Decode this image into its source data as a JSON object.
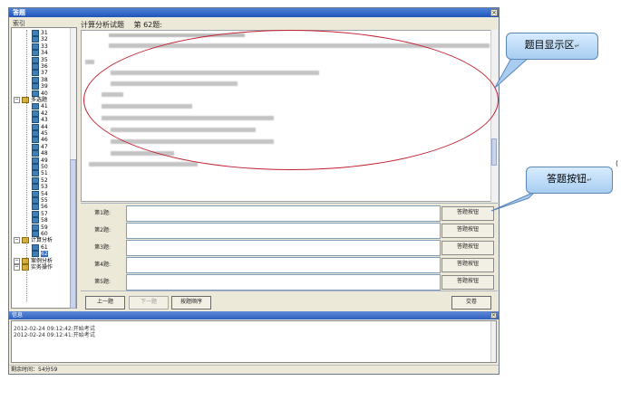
{
  "window": {
    "title": "答题"
  },
  "tree": {
    "title": "索引",
    "items": [
      {
        "label": "31",
        "type": "q"
      },
      {
        "label": "32",
        "type": "q"
      },
      {
        "label": "33",
        "type": "q"
      },
      {
        "label": "34",
        "type": "q"
      },
      {
        "label": "35",
        "type": "q"
      },
      {
        "label": "36",
        "type": "q"
      },
      {
        "label": "37",
        "type": "q"
      },
      {
        "label": "38",
        "type": "q"
      },
      {
        "label": "39",
        "type": "q"
      },
      {
        "label": "40",
        "type": "q"
      },
      {
        "label": "多选题",
        "type": "folder"
      },
      {
        "label": "41",
        "type": "q"
      },
      {
        "label": "42",
        "type": "q"
      },
      {
        "label": "43",
        "type": "q"
      },
      {
        "label": "44",
        "type": "q"
      },
      {
        "label": "45",
        "type": "q"
      },
      {
        "label": "46",
        "type": "q"
      },
      {
        "label": "47",
        "type": "q"
      },
      {
        "label": "48",
        "type": "q"
      },
      {
        "label": "49",
        "type": "q"
      },
      {
        "label": "50",
        "type": "q"
      },
      {
        "label": "51",
        "type": "q"
      },
      {
        "label": "52",
        "type": "q"
      },
      {
        "label": "53",
        "type": "q"
      },
      {
        "label": "54",
        "type": "q"
      },
      {
        "label": "55",
        "type": "q"
      },
      {
        "label": "56",
        "type": "q"
      },
      {
        "label": "57",
        "type": "q"
      },
      {
        "label": "58",
        "type": "q"
      },
      {
        "label": "59",
        "type": "q"
      },
      {
        "label": "60",
        "type": "q"
      },
      {
        "label": "计算分析",
        "type": "folder"
      },
      {
        "label": "61",
        "type": "q"
      },
      {
        "label": "62",
        "type": "q",
        "selected": true
      },
      {
        "label": "案例分析",
        "type": "folder"
      },
      {
        "label": "实务操作",
        "type": "folder"
      }
    ]
  },
  "question": {
    "category": "计算分析试题",
    "number": "第 62题:"
  },
  "answers": {
    "rows": [
      {
        "label": "第1题:",
        "button": "答题按钮"
      },
      {
        "label": "第2题:",
        "button": "答题按钮"
      },
      {
        "label": "第3题:",
        "button": "答题按钮"
      },
      {
        "label": "第4题:",
        "button": "答题按钮"
      },
      {
        "label": "第5题:",
        "button": "答题按钮"
      }
    ]
  },
  "nav": {
    "prev": "上一题",
    "next": "下一题",
    "order": "按题顺序",
    "submit": "交卷"
  },
  "log": {
    "title": "信息",
    "lines": [
      "2012-02-24 09:12:42:开始考试",
      "2012-02-24 09:12:41:开始考试"
    ]
  },
  "status": {
    "text": "剩余时间：54分59"
  },
  "callouts": {
    "display": "题目显示区",
    "answer": "答题按钮"
  },
  "colors": {
    "titlebar": "#1f55b8",
    "highlight": "#c02030",
    "callout": "#a8cdf0"
  }
}
